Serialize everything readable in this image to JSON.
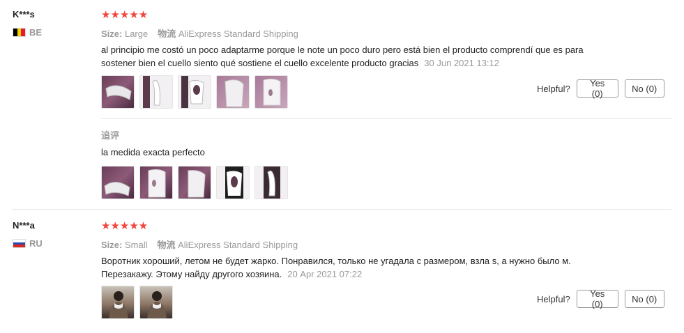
{
  "reviews": [
    {
      "user": "K***s",
      "country_code": "BE",
      "flag_colors": [
        "#000000",
        "#f2d100",
        "#e8182d"
      ],
      "stars": "★★★★★",
      "rating": 5,
      "size_label": "Size:",
      "size_value": "Large",
      "shipping_label": "物流",
      "shipping_value": "AliExpress Standard Shipping",
      "text": "al principio me costó un poco adaptarme porque le note un poco duro pero está bien el producto comprendí que es para sostener bien el cuello siento qué sostiene el cuello excelente producto gracias",
      "date": "30 Jun 2021 13:12",
      "photo_count": 5,
      "additional_label": "追评",
      "additional_text": "la medida exacta perfecto",
      "additional_photo_count": 5
    },
    {
      "user": "N***a",
      "country_code": "RU",
      "flag_colors": [
        "#ffffff",
        "#2b47b3",
        "#d52b1e"
      ],
      "stars": "★★★★★",
      "rating": 5,
      "size_label": "Size:",
      "size_value": "Small",
      "shipping_label": "物流",
      "shipping_value": "AliExpress Standard Shipping",
      "text": "Воротник хороший, летом не будет жарко. Понравился, только не угадала с размером, взла s, а нужно было м. Перезакажу. Этому найду другого хозяина.",
      "date": "20 Apr 2021 07:22",
      "photo_count": 2
    }
  ],
  "helpful": {
    "label": "Helpful?",
    "yes_label": "Yes (0)",
    "no_label": "No (0)"
  },
  "colors": {
    "star": "#f0453a",
    "muted_text": "#999999",
    "border": "#e8e8e8"
  }
}
